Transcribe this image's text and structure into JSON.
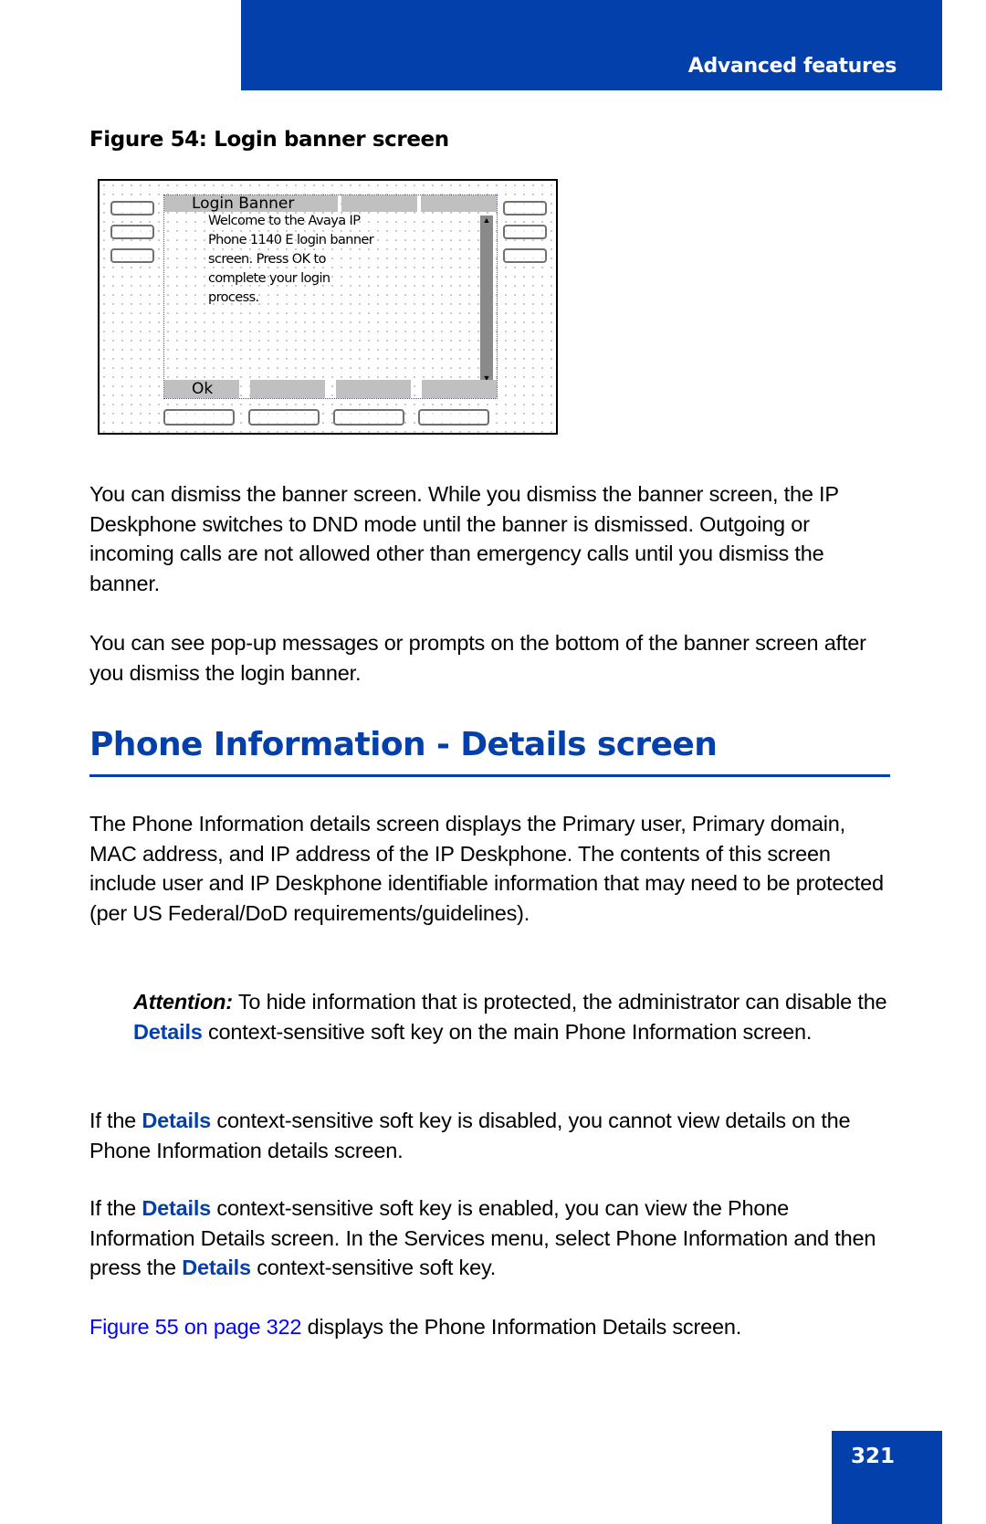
{
  "header": {
    "section_title": "Advanced features"
  },
  "figure54": {
    "caption": "Figure 54: Login banner screen",
    "screen": {
      "title": "Login Banner",
      "message_lines": [
        "Welcome to the  Avaya IP",
        "Phone 1140 E login banner",
        "screen.   Press  OK to",
        "complete your login",
        "process."
      ],
      "scroll_up_icon": "▲",
      "scroll_down_icon": "▼",
      "soft_keys": [
        "Ok",
        "",
        "",
        ""
      ]
    }
  },
  "body": {
    "p1": "You can dismiss the banner screen. While you dismiss the banner screen, the IP Deskphone switches to DND mode until the banner is dismissed. Outgoing or incoming calls are not allowed other than emergency calls until you dismiss the banner.",
    "p2": "You can see pop-up messages or prompts on the bottom of the banner screen after you dismiss the login banner."
  },
  "section": {
    "heading": "Phone Information - Details screen",
    "p3": "The Phone Information details screen displays the Primary user, Primary domain, MAC address, and IP address of the IP Deskphone. The contents of this screen include user and IP Deskphone identifiable information that may need to be protected (per US Federal/DoD requirements/guidelines).",
    "attention": {
      "label": "Attention:",
      "pre": " To hide information that is protected, the administrator can disable the ",
      "kw": "Details",
      "post": " context-sensitive soft key on the main Phone Information screen."
    },
    "p4": {
      "pre": "If the ",
      "kw": "Details",
      "post": " context-sensitive soft key is disabled, you cannot view details on the Phone Information details screen."
    },
    "p5": {
      "pre": "If the ",
      "kw": "Details",
      "mid": " context-sensitive soft key is enabled, you can view the Phone Information Details screen. In the Services menu, select Phone Information and then press the ",
      "kw2": "Details",
      "post": " context-sensitive soft key."
    },
    "p6": {
      "link": "Figure 55 on page 322",
      "post": " displays the Phone Information Details screen."
    }
  },
  "footer": {
    "page_number": "321"
  }
}
